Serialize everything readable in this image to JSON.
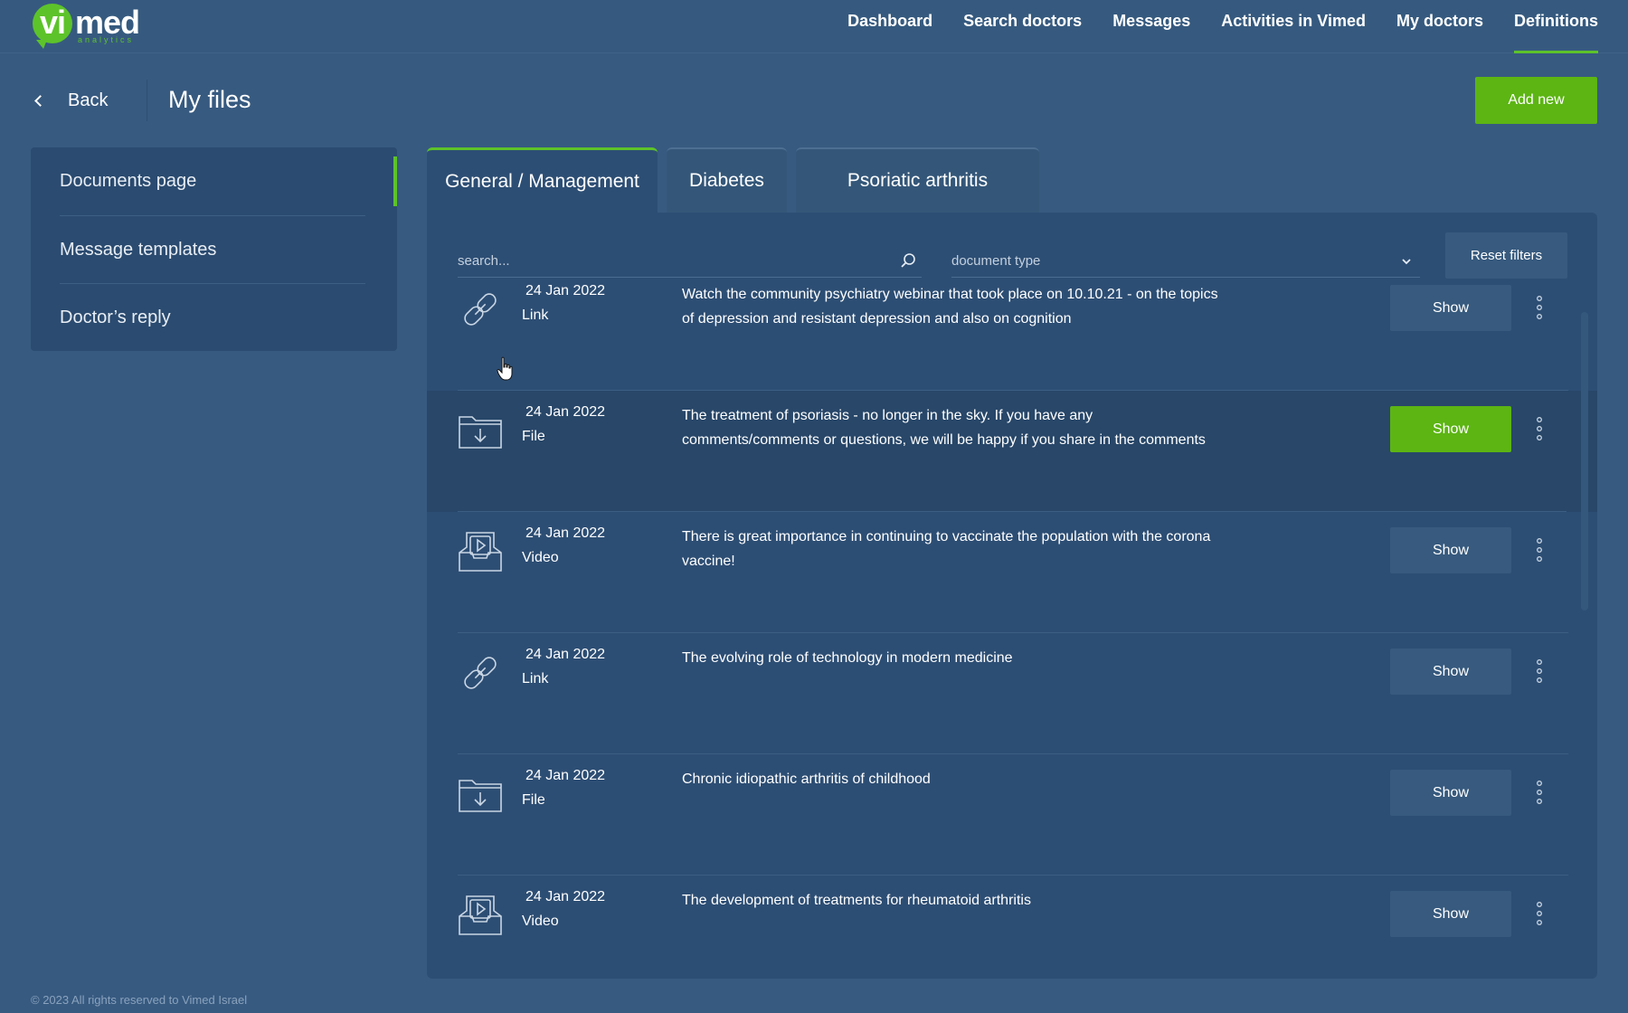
{
  "brand": {
    "logo_main": "vi",
    "logo_second": "med",
    "logo_sub": "analytics",
    "accent": "#5dc32a"
  },
  "nav": [
    {
      "label": "Dashboard",
      "active": false
    },
    {
      "label": "Search doctors",
      "active": false
    },
    {
      "label": "Messages",
      "active": false
    },
    {
      "label": "Activities in Vimed",
      "active": false
    },
    {
      "label": "My doctors",
      "active": false
    },
    {
      "label": "Definitions",
      "active": true
    }
  ],
  "header": {
    "back_label": "Back",
    "title": "My files",
    "add_new_label": "Add new"
  },
  "sidebar": {
    "items": [
      {
        "label": "Documents page",
        "active": true
      },
      {
        "label": "Message templates",
        "active": false
      },
      {
        "label": "Doctor’s reply",
        "active": false
      }
    ]
  },
  "tabs": [
    {
      "label": "General / Management",
      "active": true
    },
    {
      "label": "Diabetes",
      "active": false
    },
    {
      "label": "Psoriatic arthritis",
      "active": false
    }
  ],
  "filters": {
    "search_placeholder": "search...",
    "doctype_placeholder": "document type",
    "reset_label": "Reset filters"
  },
  "rows": [
    {
      "date": "24 Jan 2022",
      "type": "Link",
      "icon": "link-icon",
      "description": "Watch the community psychiatry webinar that took place on 10.10.21 - on the topics of depression and resistant depression and also on cognition",
      "action": "Show",
      "highlight": false
    },
    {
      "date": "24 Jan 2022",
      "type": "File",
      "icon": "folder-download-icon",
      "description": "The treatment of psoriasis - no longer in the sky. If you have any comments/comments or questions, we will be happy if you share in the comments",
      "action": "Show",
      "highlight": true
    },
    {
      "date": "24 Jan 2022",
      "type": "Video",
      "icon": "video-icon",
      "description": "There is great importance in continuing to vaccinate the population with the corona vaccine!",
      "action": "Show",
      "highlight": false
    },
    {
      "date": "24 Jan 2022",
      "type": "Link",
      "icon": "link-icon",
      "description": "The evolving role of technology in modern medicine",
      "action": "Show",
      "highlight": false
    },
    {
      "date": "24 Jan 2022",
      "type": "File",
      "icon": "folder-download-icon",
      "description": "Chronic idiopathic arthritis of childhood",
      "action": "Show",
      "highlight": false
    },
    {
      "date": "24 Jan 2022",
      "type": "Video",
      "icon": "video-icon",
      "description": "The development of treatments for rheumatoid arthritis",
      "action": "Show",
      "highlight": false
    }
  ],
  "footer": "© 2023 All rights reserved to Vimed Israel"
}
